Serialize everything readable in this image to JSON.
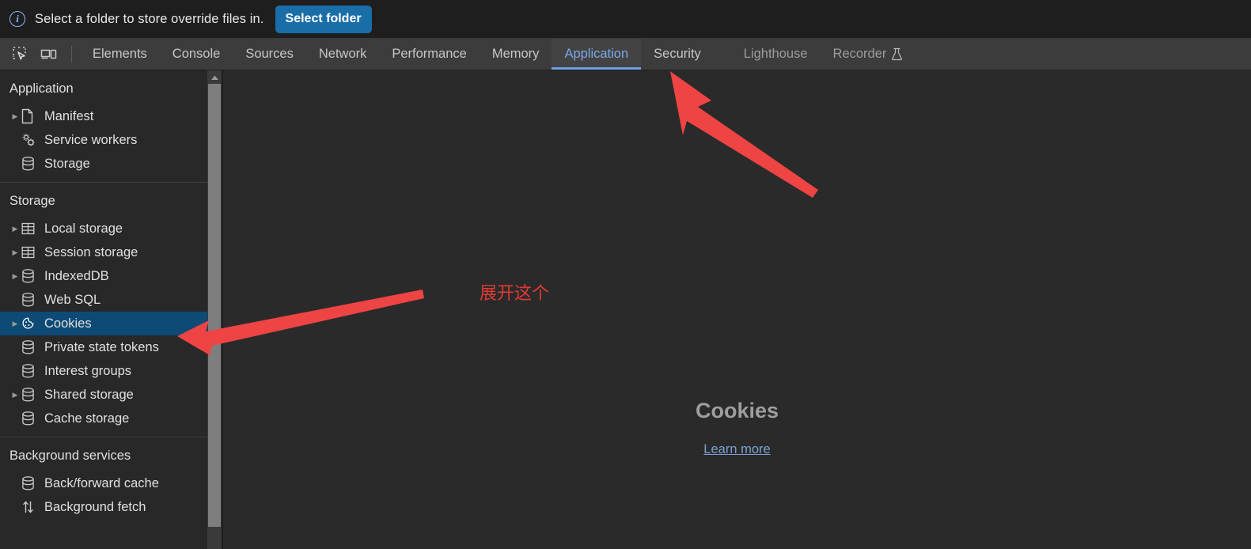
{
  "infobar": {
    "icon": "info-circle-icon",
    "message": "Select a folder to store override files in.",
    "button_label": "Select folder",
    "button_color": "#1a6ea8"
  },
  "tabbar": {
    "left_icons": [
      {
        "name": "inspect-element-icon"
      },
      {
        "name": "device-toolbar-icon"
      }
    ],
    "tabs": [
      {
        "label": "Elements",
        "active": false
      },
      {
        "label": "Console",
        "active": false
      },
      {
        "label": "Sources",
        "active": false
      },
      {
        "label": "Network",
        "active": false
      },
      {
        "label": "Performance",
        "active": false
      },
      {
        "label": "Memory",
        "active": false
      },
      {
        "label": "Application",
        "active": true
      },
      {
        "label": "Security",
        "active": false
      },
      {
        "label": "Lighthouse",
        "active": false
      },
      {
        "label": "Recorder",
        "active": false,
        "icon": "experiment-flask-icon"
      }
    ],
    "active_tab": "Application",
    "active_color": "#6ba0e8"
  },
  "sidebar": {
    "sections": [
      {
        "title": "Application",
        "items": [
          {
            "label": "Manifest",
            "icon": "document-icon",
            "expandable": true,
            "selected": false
          },
          {
            "label": "Service workers",
            "icon": "gears-icon",
            "expandable": false,
            "selected": false
          },
          {
            "label": "Storage",
            "icon": "database-icon",
            "expandable": false,
            "selected": false
          }
        ]
      },
      {
        "title": "Storage",
        "items": [
          {
            "label": "Local storage",
            "icon": "table-icon",
            "expandable": true,
            "selected": false
          },
          {
            "label": "Session storage",
            "icon": "table-icon",
            "expandable": true,
            "selected": false
          },
          {
            "label": "IndexedDB",
            "icon": "database-icon",
            "expandable": true,
            "selected": false
          },
          {
            "label": "Web SQL",
            "icon": "database-icon",
            "expandable": false,
            "selected": false
          },
          {
            "label": "Cookies",
            "icon": "cookie-icon",
            "expandable": true,
            "selected": true
          },
          {
            "label": "Private state tokens",
            "icon": "database-icon",
            "expandable": false,
            "selected": false
          },
          {
            "label": "Interest groups",
            "icon": "database-icon",
            "expandable": false,
            "selected": false
          },
          {
            "label": "Shared storage",
            "icon": "database-icon",
            "expandable": true,
            "selected": false
          },
          {
            "label": "Cache storage",
            "icon": "database-icon",
            "expandable": false,
            "selected": false
          }
        ]
      },
      {
        "title": "Background services",
        "items": [
          {
            "label": "Back/forward cache",
            "icon": "database-icon",
            "expandable": false,
            "selected": false
          },
          {
            "label": "Background fetch",
            "icon": "up-down-arrows-icon",
            "expandable": false,
            "selected": false
          }
        ]
      }
    ],
    "selection_color": "#0d4a75",
    "scrollbar": {
      "name": "sidebar-scrollbar"
    }
  },
  "content": {
    "empty_title": "Cookies",
    "learn_more_label": "Learn more",
    "link_color": "#7b9fd6"
  },
  "annotations": {
    "note_text": "展开这个",
    "note_color": "#e03a34",
    "arrow_color": "#ef4444",
    "arrows": [
      {
        "name": "arrow-to-application-tab",
        "points_to": "Application"
      },
      {
        "name": "arrow-to-cookies-item",
        "points_to": "Cookies"
      }
    ]
  }
}
